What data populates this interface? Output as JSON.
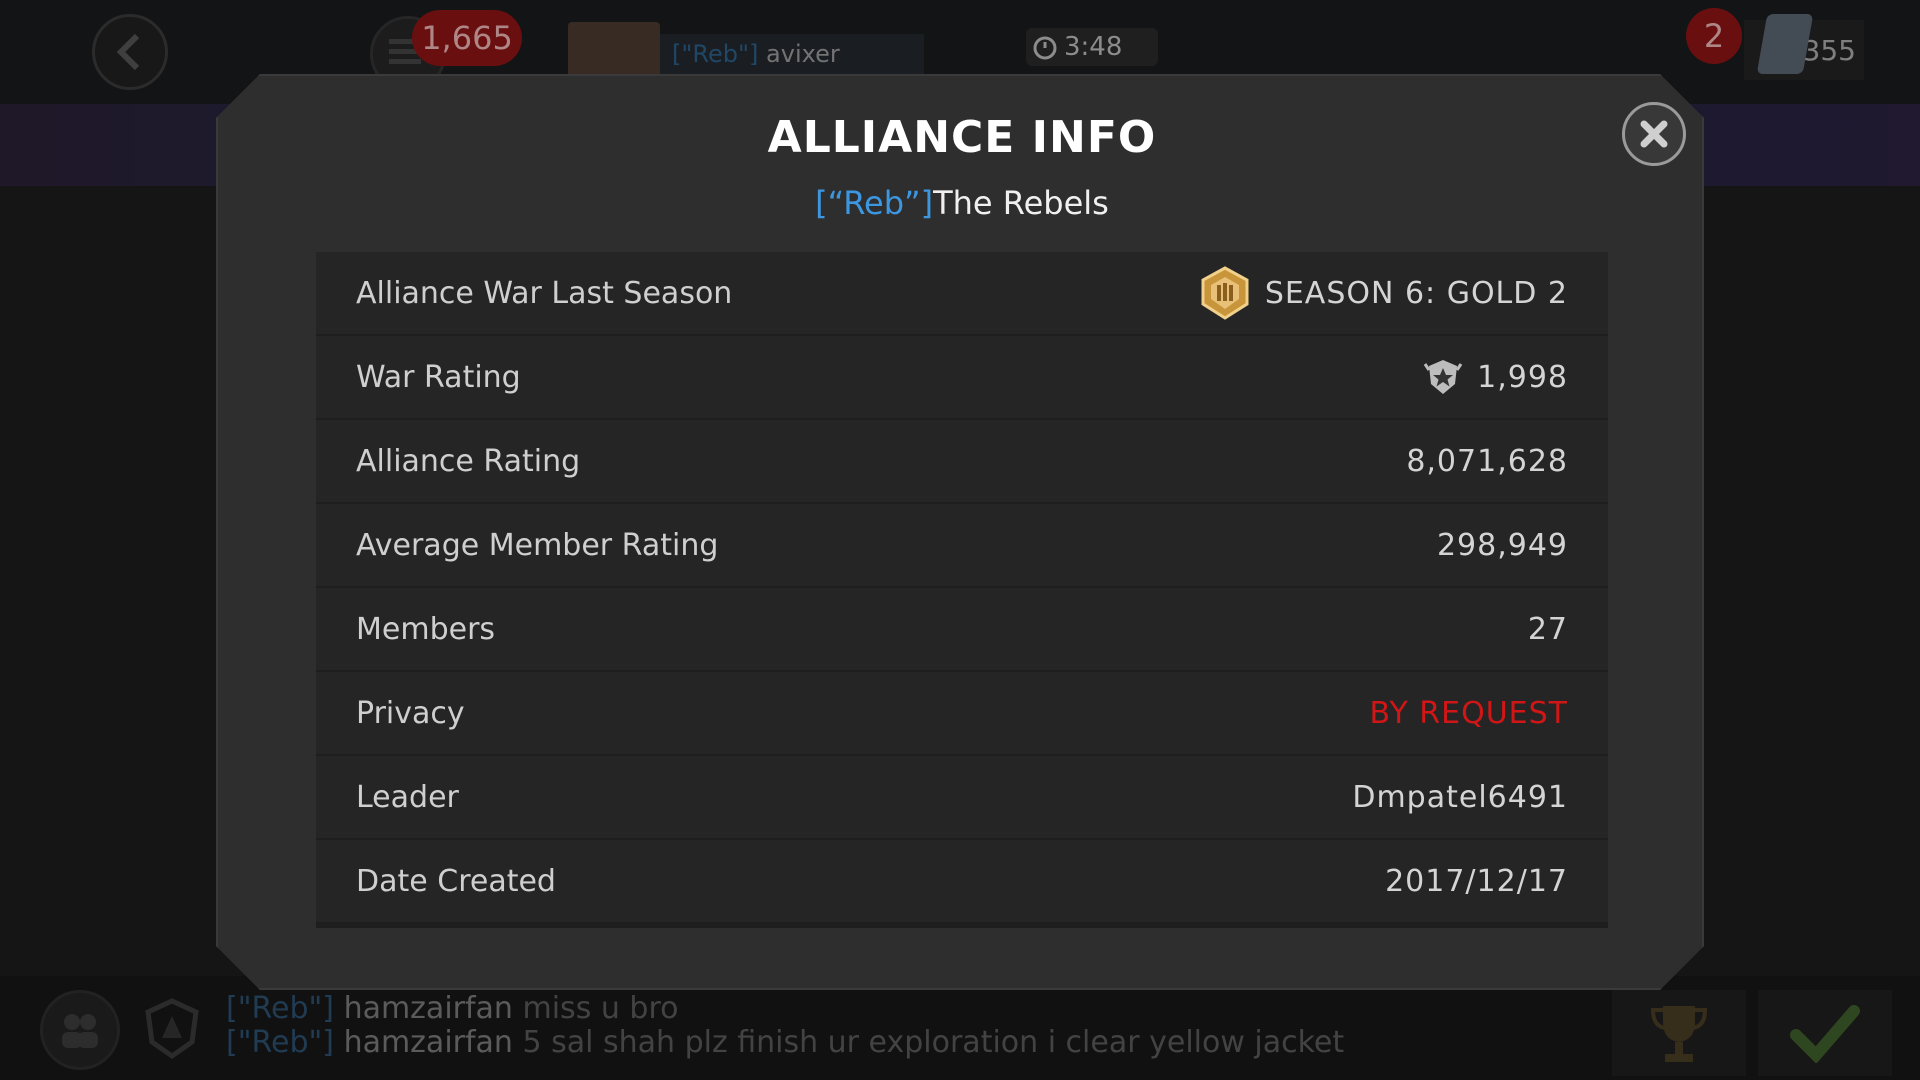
{
  "hud": {
    "gold_count": "1,665",
    "player_tag": "[\"Reb\"]",
    "player_name": "avixer",
    "timer": "3:48",
    "notification_count": "2",
    "unit_count": "355"
  },
  "modal": {
    "title": "ALLIANCE INFO",
    "alliance_tag": "[“Reb”]",
    "alliance_name": "The Rebels",
    "rows": [
      {
        "label": "Alliance War Last Season",
        "value": "SEASON 6: GOLD 2"
      },
      {
        "label": "War Rating",
        "value": "1,998"
      },
      {
        "label": "Alliance Rating",
        "value": "8,071,628"
      },
      {
        "label": "Average Member Rating",
        "value": "298,949"
      },
      {
        "label": "Members",
        "value": "27"
      },
      {
        "label": "Privacy",
        "value": "BY REQUEST"
      },
      {
        "label": "Leader",
        "value": "Dmpatel6491"
      },
      {
        "label": "Date Created",
        "value": "2017/12/17"
      }
    ]
  },
  "chat": {
    "messages": [
      {
        "tag": "[\"Reb\"]",
        "user": "hamzairfan",
        "text": "miss u bro"
      },
      {
        "tag": "[\"Reb\"]",
        "user": "hamzairfan",
        "text": "5 sal shah plz finish ur exploration i clear yellow jacket"
      }
    ]
  },
  "colors": {
    "accent_tag": "#3d97e0",
    "privacy_status": "#d01616",
    "modal_bg": "#2e2e2e"
  }
}
